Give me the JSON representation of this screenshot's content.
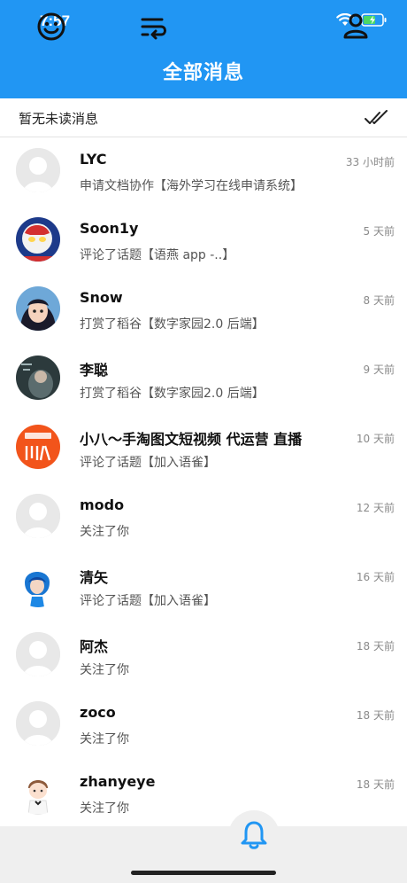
{
  "status_bar": {
    "time": "7:57"
  },
  "header": {
    "title": "全部消息"
  },
  "unread_bar": {
    "text": "暂无未读消息"
  },
  "messages": [
    {
      "name": "LYC",
      "time": "33 小时前",
      "text": "申请文档协作【海外学习在线申请系统】",
      "avatar": "default"
    },
    {
      "name": "Soon1y",
      "time": "5 天前",
      "text": "评论了话题【语燕 app -..】",
      "avatar": "ultraman"
    },
    {
      "name": "Snow",
      "time": "8 天前",
      "text": "打赏了稻谷【数字家园2.0 后端】",
      "avatar": "anime-girl"
    },
    {
      "name": "李聪",
      "time": "9 天前",
      "text": "打赏了稻谷【数字家园2.0 后端】",
      "avatar": "dark-photo"
    },
    {
      "name": "小八～手淘图文短视频 代运营 直播",
      "time": "10 天前",
      "text": "评论了话题【加入语雀】",
      "avatar": "orange-logo"
    },
    {
      "name": "modo",
      "time": "12 天前",
      "text": "关注了你",
      "avatar": "default"
    },
    {
      "name": "清矢",
      "time": "16 天前",
      "text": "评论了话题【加入语雀】",
      "avatar": "blue-hair"
    },
    {
      "name": "阿杰",
      "time": "18 天前",
      "text": "关注了你",
      "avatar": "default"
    },
    {
      "name": "zoco",
      "time": "18 天前",
      "text": "关注了你",
      "avatar": "default"
    },
    {
      "name": "zhanyeye",
      "time": "18 天前",
      "text": "关注了你",
      "avatar": "cartoon-boy"
    }
  ],
  "tabbar": {
    "tabs": [
      {
        "icon": "smile-icon"
      },
      {
        "icon": "list-swap-icon"
      },
      {
        "icon": "bell-icon",
        "active": true
      },
      {
        "icon": "person-icon"
      }
    ]
  },
  "colors": {
    "accent": "#2196F3",
    "tab_inactive": "#111111"
  }
}
